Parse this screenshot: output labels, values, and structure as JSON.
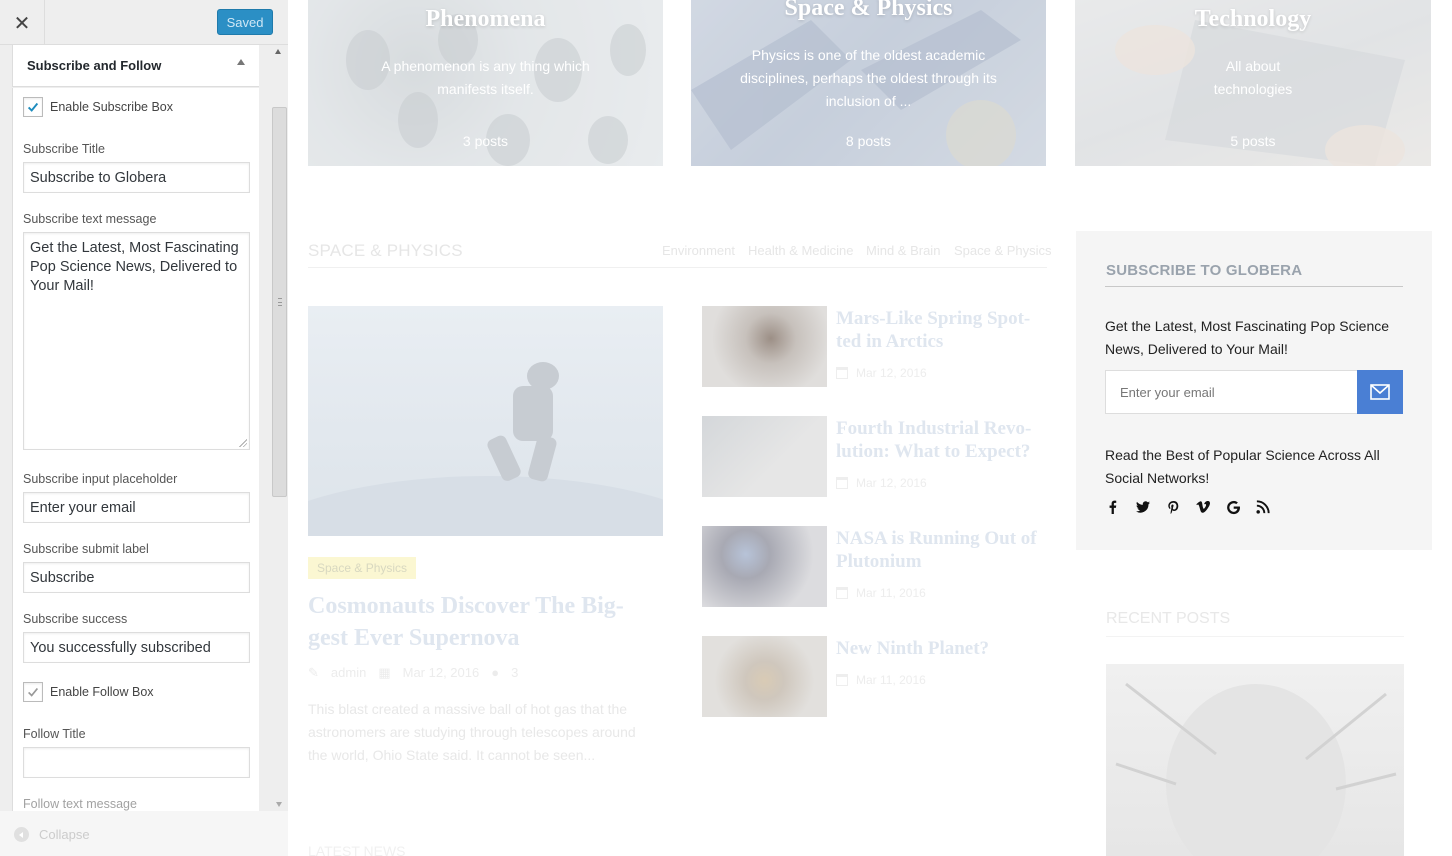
{
  "panel": {
    "close_glyph": "✕",
    "saved_label": "Saved",
    "section_title": "Subscribe and Follow",
    "enable_subscribe_label": "Enable Subscribe Box",
    "subscribe_title_label": "Subscribe Title",
    "subscribe_title_value": "Subscribe to Globera",
    "subscribe_text_label": "Subscribe text message",
    "subscribe_text_value": "Get the Latest, Most Fascinating Pop Science News, Delivered to Your Mail!",
    "placeholder_label": "Subscribe input placeholder",
    "placeholder_value": "Enter your email",
    "submit_label": "Subscribe submit label",
    "submit_value": "Subscribe",
    "success_label": "Subscribe success",
    "success_value": "You successfully subscribed",
    "enable_follow_label": "Enable Follow Box",
    "follow_title_label": "Follow Title",
    "follow_title_value": "",
    "follow_text_label": "Follow text message",
    "collapse_label": "Collapse"
  },
  "preview": {
    "categories": [
      {
        "title": "Phenomena",
        "desc": "A phenomenon is any thing which manifests itself.",
        "count": "3 posts"
      },
      {
        "title": "Space & Physics",
        "desc": "Physics is one of the oldest academic disciplines, perhaps the oldest through its inclusion of ...",
        "count": "8 posts"
      },
      {
        "title": "Technology",
        "desc": "All about technologies",
        "count": "5 posts"
      }
    ],
    "section_title": "SPACE & PHYSICS",
    "tabs": [
      "Environment",
      "Health & Medicine",
      "Mind & Brain",
      "Space & Physics"
    ],
    "featured": {
      "tag": "Space & Physics",
      "title": "Cosmonauts Discover The Big-gest Ever Supernova",
      "author": "admin",
      "date": "Mar 12, 2016",
      "comments": "3",
      "excerpt": "This blast created a massive ball of hot gas that the astronomers are studying through telescopes around the world, Ohio State said. It cannot be seen..."
    },
    "list": [
      {
        "title": "Mars-Like Spring Spot-ted in Arctics",
        "date": "Mar 12, 2016"
      },
      {
        "title": "Fourth Industrial Revo-lution: What to Expect?",
        "date": "Mar 12, 2016"
      },
      {
        "title": "NASA is Running Out of Plutonium",
        "date": "Mar 11, 2016"
      },
      {
        "title": "New Ninth Planet?",
        "date": "Mar 11, 2016"
      }
    ],
    "widget": {
      "title": "SUBSCRIBE TO GLOBERA",
      "text": "Get the Latest, Most Fascinating Pop Science News, Delivered to Your Mail!",
      "placeholder": "Enter your email",
      "follow_text": "Read the Best of Popular Science Across All Social Networks!",
      "social_icons": [
        "facebook-icon",
        "twitter-icon",
        "pinterest-icon",
        "vimeo-icon",
        "google-icon",
        "rss-icon"
      ],
      "accent": "#4a7fd4"
    },
    "recent_title": "RECENT POSTS",
    "bottom_heading": "LATEST NEWS"
  }
}
